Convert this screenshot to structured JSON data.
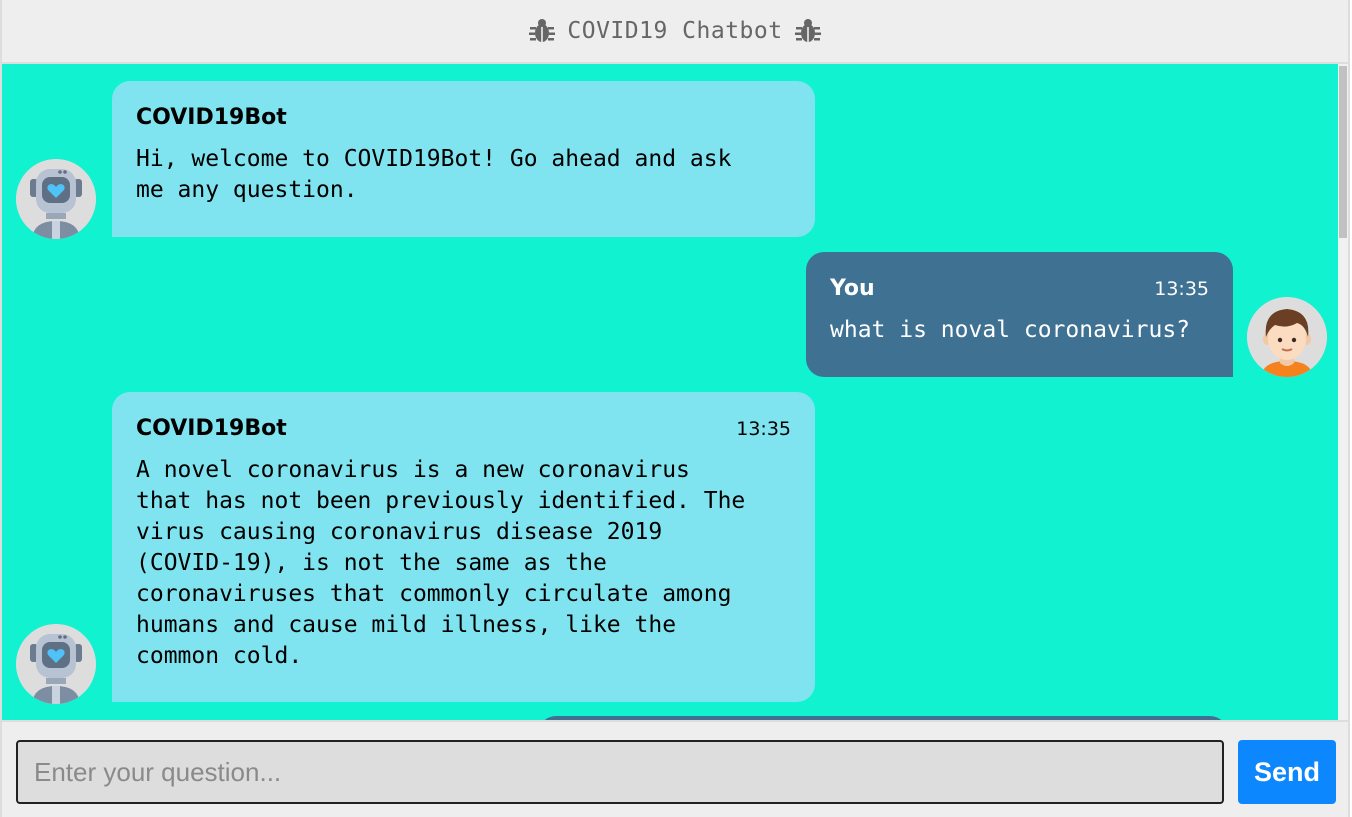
{
  "header": {
    "title": "COVID19 Chatbot",
    "left_icon": "bug-icon",
    "right_icon": "bug-icon",
    "text_color": "#666666"
  },
  "colors": {
    "chat_background": "#10f2d0",
    "bot_bubble": "#7fe4ef",
    "user_bubble": "#3f7193",
    "send_button": "#0d87fd"
  },
  "messages": [
    {
      "sender": "COVID19Bot",
      "side": "left",
      "time": "",
      "avatar": "robot-avatar",
      "text": "Hi, welcome to COVID19Bot! Go ahead and ask\nme any question."
    },
    {
      "sender": "You",
      "side": "right",
      "time": "13:35",
      "avatar": "boy-avatar",
      "text": "what is noval coronavirus?"
    },
    {
      "sender": "COVID19Bot",
      "side": "left",
      "time": "13:35",
      "avatar": "robot-avatar",
      "text": "A novel coronavirus is a new coronavirus\nthat has not been previously identified. The\nvirus causing coronavirus disease 2019\n(COVID-19), is not the same as the\ncoronaviruses that commonly circulate among\nhumans and cause mild illness, like the\ncommon cold."
    }
  ],
  "input": {
    "placeholder": "Enter your question...",
    "value": ""
  },
  "send_button": {
    "label": "Send"
  }
}
